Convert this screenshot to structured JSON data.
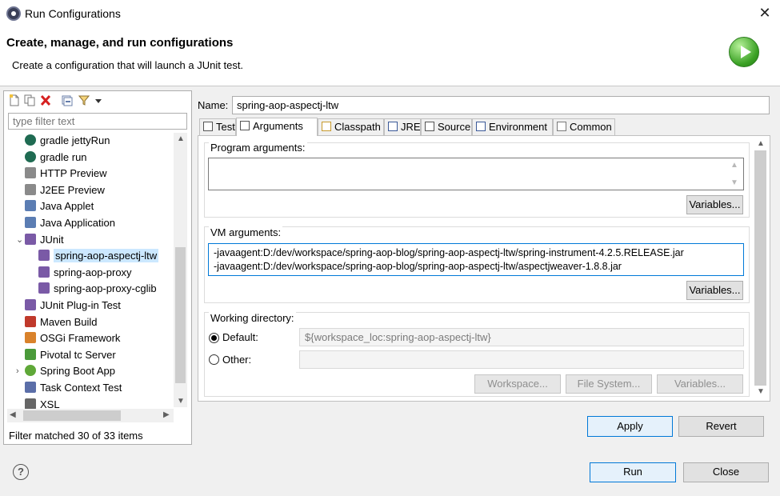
{
  "window": {
    "title": "Run Configurations",
    "close_glyph": "✕"
  },
  "banner": {
    "title": "Create, manage, and run configurations",
    "description": "Create a configuration that will launch a JUnit test.",
    "icon": "run-launch-icon"
  },
  "left": {
    "toolbar_icons": [
      "new-config-icon",
      "duplicate-icon",
      "delete-icon",
      "collapse-all-icon",
      "filter-icon",
      "view-menu-icon"
    ],
    "filter_placeholder": "type filter text",
    "tree_items": [
      {
        "label": "gradle jettyRun",
        "icon": "gradle-icon",
        "level": 1
      },
      {
        "label": "gradle run",
        "icon": "gradle-icon",
        "level": 1
      },
      {
        "label": "HTTP Preview",
        "icon": "http-preview-icon",
        "level": 1
      },
      {
        "label": "J2EE Preview",
        "icon": "j2ee-preview-icon",
        "level": 1
      },
      {
        "label": "Java Applet",
        "icon": "java-applet-icon",
        "level": 1
      },
      {
        "label": "Java Application",
        "icon": "java-application-icon",
        "level": 1
      },
      {
        "label": "JUnit",
        "icon": "junit-icon",
        "level": 1,
        "expanded": true
      },
      {
        "label": "spring-aop-aspectj-ltw",
        "icon": "junit-icon",
        "level": 2,
        "selected": true
      },
      {
        "label": "spring-aop-proxy",
        "icon": "junit-icon",
        "level": 2
      },
      {
        "label": "spring-aop-proxy-cglib",
        "icon": "junit-icon",
        "level": 2
      },
      {
        "label": "JUnit Plug-in Test",
        "icon": "junit-plugin-icon",
        "level": 1
      },
      {
        "label": "Maven Build",
        "icon": "maven-icon",
        "level": 1
      },
      {
        "label": "OSGi Framework",
        "icon": "osgi-icon",
        "level": 1
      },
      {
        "label": "Pivotal tc Server",
        "icon": "tc-server-icon",
        "level": 1
      },
      {
        "label": "Spring Boot App",
        "icon": "spring-boot-icon",
        "level": 1,
        "collapsed": true
      },
      {
        "label": "Task Context Test",
        "icon": "task-context-icon",
        "level": 1
      },
      {
        "label": "XSL",
        "icon": "xsl-icon",
        "level": 1
      }
    ],
    "filter_status": "Filter matched 30 of 33 items"
  },
  "config": {
    "name_label": "Name:",
    "name_value": "spring-aop-aspectj-ltw",
    "tabs": [
      {
        "label": "Test",
        "icon": "test-tab-icon"
      },
      {
        "label": "Arguments",
        "icon": "arguments-tab-icon",
        "active": true
      },
      {
        "label": "Classpath",
        "icon": "classpath-tab-icon"
      },
      {
        "label": "JRE",
        "icon": "jre-tab-icon"
      },
      {
        "label": "Source",
        "icon": "source-tab-icon"
      },
      {
        "label": "Environment",
        "icon": "environment-tab-icon"
      },
      {
        "label": "Common",
        "icon": "common-tab-icon"
      }
    ],
    "program_args_label": "Program arguments:",
    "program_args_value": "",
    "variables_label": "Variables...",
    "vm_args_label": "VM arguments:",
    "vm_args_lines": [
      "-javaagent:D:/dev/workspace/spring-aop-blog/spring-aop-aspectj-ltw/spring-instrument-4.2.5.RELEASE.jar",
      "-javaagent:D:/dev/workspace/spring-aop-blog/spring-aop-aspectj-ltw/aspectjweaver-1.8.8.jar"
    ],
    "working_dir_label": "Working directory:",
    "default_label": "Default:",
    "default_value": "${workspace_loc:spring-aop-aspectj-ltw}",
    "other_label": "Other:",
    "other_value": "",
    "workspace_btn": "Workspace...",
    "filesystem_btn": "File System...",
    "apply_btn": "Apply",
    "revert_btn": "Revert"
  },
  "footer": {
    "help_glyph": "?",
    "run_btn": "Run",
    "close_btn": "Close"
  }
}
